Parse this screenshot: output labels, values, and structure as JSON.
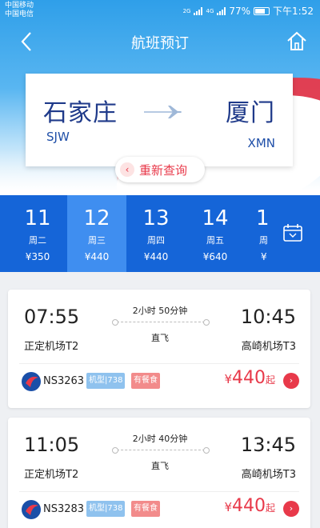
{
  "status_bar": {
    "carrier1": "中国移动",
    "carrier2": "中国电信",
    "network1": "2G",
    "network2": "4G",
    "battery": "77%",
    "time": "下午1:52"
  },
  "nav": {
    "title": "航班预订",
    "back_icon": "chevron-left-icon",
    "home_icon": "home-icon"
  },
  "route": {
    "from_city": "石家庄",
    "from_code": "SJW",
    "to_city": "厦门",
    "to_code": "XMN",
    "requery_label": "重新查询"
  },
  "dates": [
    {
      "day": "11",
      "weekday": "周二",
      "price": "¥350"
    },
    {
      "day": "12",
      "weekday": "周三",
      "price": "¥440",
      "selected": true
    },
    {
      "day": "13",
      "weekday": "周四",
      "price": "¥440"
    },
    {
      "day": "14",
      "weekday": "周五",
      "price": "¥640"
    },
    {
      "day": "1",
      "weekday": "周",
      "price": "¥"
    }
  ],
  "flights": [
    {
      "dep_time": "07:55",
      "arr_time": "10:45",
      "dep_airport": "正定机场T2",
      "arr_airport": "高崎机场T3",
      "duration": "2小时 50分钟",
      "type": "直飞",
      "flight_no": "NS3263",
      "model": "机型|738",
      "meal": "有餐食",
      "currency": "¥",
      "price": "440",
      "price_suffix": "起"
    },
    {
      "dep_time": "11:05",
      "arr_time": "13:45",
      "dep_airport": "正定机场T2",
      "arr_airport": "高崎机场T3",
      "duration": "2小时 40分钟",
      "type": "直飞",
      "flight_no": "NS3283",
      "model": "机型|738",
      "meal": "有餐食",
      "currency": "¥",
      "price": "440",
      "price_suffix": "起"
    }
  ],
  "colors": {
    "primary_blue": "#1565d8",
    "selected_blue": "#3f8ef0",
    "accent_red": "#e8394a"
  }
}
